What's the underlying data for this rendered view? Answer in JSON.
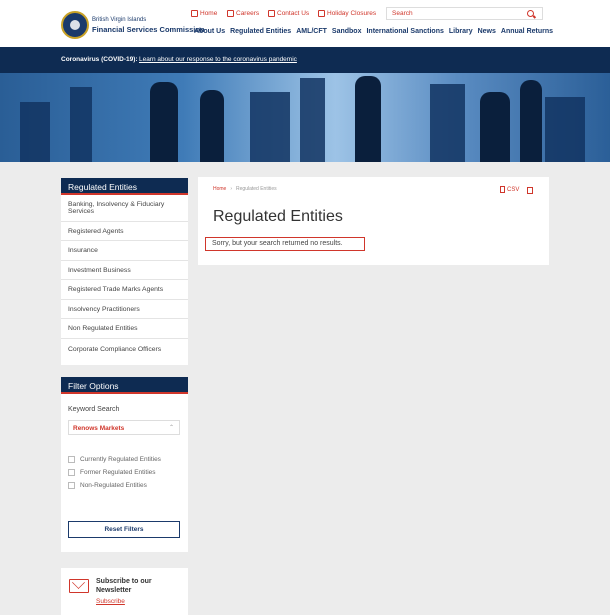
{
  "brand": {
    "line1": "British Virgin Islands",
    "line2": "Financial Services Commission"
  },
  "utility_nav": [
    {
      "label": "Home",
      "icon": "home-icon"
    },
    {
      "label": "Careers",
      "icon": "briefcase-icon"
    },
    {
      "label": "Contact Us",
      "icon": "envelope-icon"
    },
    {
      "label": "Holiday Closures",
      "icon": "calendar-icon"
    }
  ],
  "search": {
    "placeholder": "Search"
  },
  "main_nav": [
    "About Us",
    "Regulated Entities",
    "AML/CFT",
    "Sandbox",
    "International Sanctions",
    "Library",
    "News",
    "Annual Returns"
  ],
  "covid": {
    "label": "Coronavirus (COVID-19):",
    "link": "Learn about our response to the coronavirus pandemic"
  },
  "sidebar": {
    "title": "Regulated Entities",
    "items": [
      "Banking, Insolvency & Fiduciary Services",
      "Registered Agents",
      "Insurance",
      "Investment Business",
      "Registered Trade Marks Agents",
      "Insolvency Practitioners",
      "Non Regulated Entities",
      "Corporate Compliance Officers"
    ]
  },
  "filter": {
    "title": "Filter Options",
    "keyword_label": "Keyword Search",
    "keyword_value": "Renows Markets",
    "checkboxes": [
      "Currently Regulated Entities",
      "Former Regulated Entities",
      "Non-Regulated Entities"
    ],
    "reset_label": "Reset Filters"
  },
  "newsletter": {
    "title": "Subscribe to our Newsletter",
    "link": "Subscribe"
  },
  "main": {
    "breadcrumb_home": "Home",
    "breadcrumb_sep": "›",
    "breadcrumb_current": "Regulated Entities",
    "csv_label": "CSV",
    "title": "Regulated Entities",
    "message": "Sorry, but your search returned no results."
  },
  "colors": {
    "navy": "#0e2b52",
    "accent_red": "#d0362b",
    "page_bg": "#ececec"
  }
}
